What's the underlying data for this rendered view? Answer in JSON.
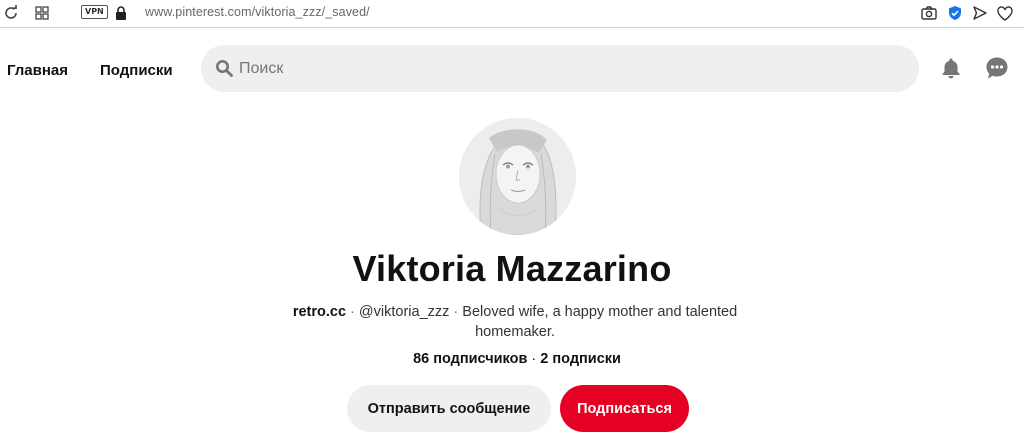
{
  "browser": {
    "vpn_label": "VPN",
    "url": "www.pinterest.com/viktoria_zzz/_saved/"
  },
  "header": {
    "nav": [
      {
        "label": "Главная"
      },
      {
        "label": "Подписки"
      }
    ],
    "search": {
      "placeholder": "Поиск",
      "value": ""
    },
    "icons": [
      "bell-icon",
      "chat-icon"
    ]
  },
  "profile": {
    "name": "Viktoria Mazzarino",
    "website": "retro.cc",
    "separator": "·",
    "username": "@viktoria_zzz",
    "bio_line1": "Beloved wife, a happy mother and talented",
    "bio_line2": "homemaker.",
    "followers": "86 подписчиков",
    "following": "2 подписки",
    "message_button": "Отправить сообщение",
    "follow_button": "Подписаться"
  },
  "colors": {
    "accent": "#e60023",
    "button_gray": "#efefef",
    "shield_blue": "#1a73e8"
  }
}
